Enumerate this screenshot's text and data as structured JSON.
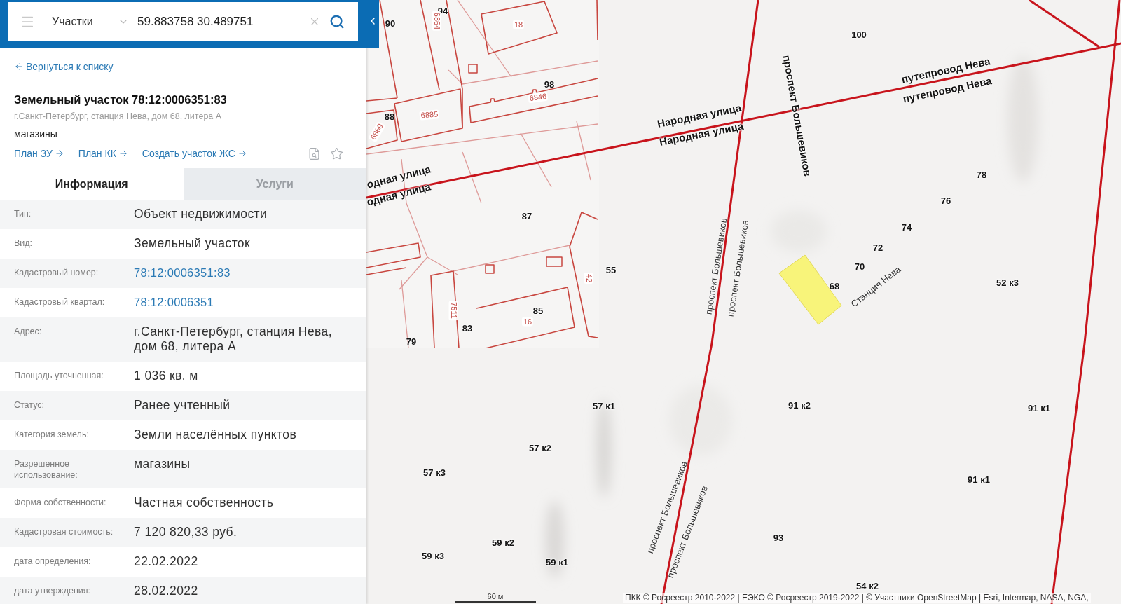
{
  "search_bar": {
    "layer": "Участки",
    "query": "59.883758 30.489751"
  },
  "back_link": "Вернуться к списку",
  "object": {
    "title": "Земельный участок 78:12:0006351:83",
    "address": "г.Санкт-Петербург, станция Нева, дом 68, литера А",
    "usage": "магазины",
    "links": [
      "План ЗУ",
      "План КК",
      "Создать участок ЖС"
    ]
  },
  "tabs": [
    {
      "label": "Информация",
      "selected": true
    },
    {
      "label": "Услуги",
      "selected": false
    }
  ],
  "info_rows": [
    {
      "label": "Тип:",
      "value": "Объект недвижимости",
      "kind": "text"
    },
    {
      "label": "Вид:",
      "value": "Земельный участок",
      "kind": "text"
    },
    {
      "label": "Кадастровый номер:",
      "value": "78:12:0006351:83",
      "kind": "link"
    },
    {
      "label": "Кадастровый квартал:",
      "value": "78:12:0006351",
      "kind": "link"
    },
    {
      "label": "Адрес:",
      "value": "г.Санкт-Петербург, станция Нева, дом 68, литера А",
      "kind": "text"
    },
    {
      "label": "Площадь уточненная:",
      "value": "1 036 кв. м",
      "kind": "text"
    },
    {
      "label": "Статус:",
      "value": "Ранее учтенный",
      "kind": "text"
    },
    {
      "label": "Категория земель:",
      "value": "Земли населённых пунктов",
      "kind": "text"
    },
    {
      "label": "Разрешенное использование:",
      "value": "магазины",
      "kind": "text"
    },
    {
      "label": "Форма собственности:",
      "value": "Частная собственность",
      "kind": "text"
    },
    {
      "label": "Кадастровая стоимость:",
      "value": "7 120 820,33 руб.",
      "kind": "text"
    },
    {
      "label": "дата определения:",
      "value": "22.02.2022",
      "kind": "text"
    },
    {
      "label": "дата утверждения:",
      "value": "28.02.2022",
      "kind": "text"
    }
  ],
  "map": {
    "labels": [
      {
        "text": "94",
        "kind": "house"
      },
      {
        "text": "6864",
        "kind": "parcel"
      },
      {
        "text": "90",
        "kind": "house"
      },
      {
        "text": "18",
        "kind": "parcel"
      },
      {
        "text": "100",
        "kind": "house"
      },
      {
        "text": "путепровод Нева",
        "kind": "street"
      },
      {
        "text": "98",
        "kind": "house"
      },
      {
        "text": "путепровод Нева",
        "kind": "street"
      },
      {
        "text": "6846",
        "kind": "parcel"
      },
      {
        "text": "проспект Большевиков",
        "kind": "street"
      },
      {
        "text": "88",
        "kind": "house"
      },
      {
        "text": "6885",
        "kind": "parcel"
      },
      {
        "text": "Народная улица",
        "kind": "street"
      },
      {
        "text": "6869",
        "kind": "parcel"
      },
      {
        "text": "Народная улица",
        "kind": "street"
      },
      {
        "text": "одная улица",
        "kind": "street"
      },
      {
        "text": "78",
        "kind": "house"
      },
      {
        "text": "одная улица",
        "kind": "street"
      },
      {
        "text": "76",
        "kind": "house"
      },
      {
        "text": "87",
        "kind": "house"
      },
      {
        "text": "74",
        "kind": "house"
      },
      {
        "text": "72",
        "kind": "house"
      },
      {
        "text": "проспект Большевиков",
        "kind": "street-thin"
      },
      {
        "text": "проспект Большевиков",
        "kind": "street-thin"
      },
      {
        "text": "70",
        "kind": "house"
      },
      {
        "text": "55",
        "kind": "house"
      },
      {
        "text": "42",
        "kind": "parcel"
      },
      {
        "text": "52 к3",
        "kind": "house"
      },
      {
        "text": "68",
        "kind": "house"
      },
      {
        "text": "Станция Нева",
        "kind": "street-thin"
      },
      {
        "text": "85",
        "kind": "house"
      },
      {
        "text": "7511",
        "kind": "parcel"
      },
      {
        "text": "16",
        "kind": "parcel"
      },
      {
        "text": "83",
        "kind": "house"
      },
      {
        "text": "79",
        "kind": "house"
      },
      {
        "text": "57 к1",
        "kind": "house"
      },
      {
        "text": "91 к2",
        "kind": "house"
      },
      {
        "text": "91 к1",
        "kind": "house"
      },
      {
        "text": "57 к2",
        "kind": "house"
      },
      {
        "text": "57 к3",
        "kind": "house"
      },
      {
        "text": "91 к1",
        "kind": "house"
      },
      {
        "text": "проспект Большевиков",
        "kind": "street-thin"
      },
      {
        "text": "проспект Большевиков",
        "kind": "street-thin"
      },
      {
        "text": "93",
        "kind": "house"
      },
      {
        "text": "59 к2",
        "kind": "house"
      },
      {
        "text": "59 к3",
        "kind": "house"
      },
      {
        "text": "59 к1",
        "kind": "house"
      },
      {
        "text": "54 к2",
        "kind": "house"
      }
    ],
    "scale": "60 м",
    "attribution": "ПКК © Росреестр 2010-2022 | ЕЭКО © Росреестр 2019-2022 | © Участники OpenStreetMap | Esri, Intermap, NASA, NGA,"
  }
}
